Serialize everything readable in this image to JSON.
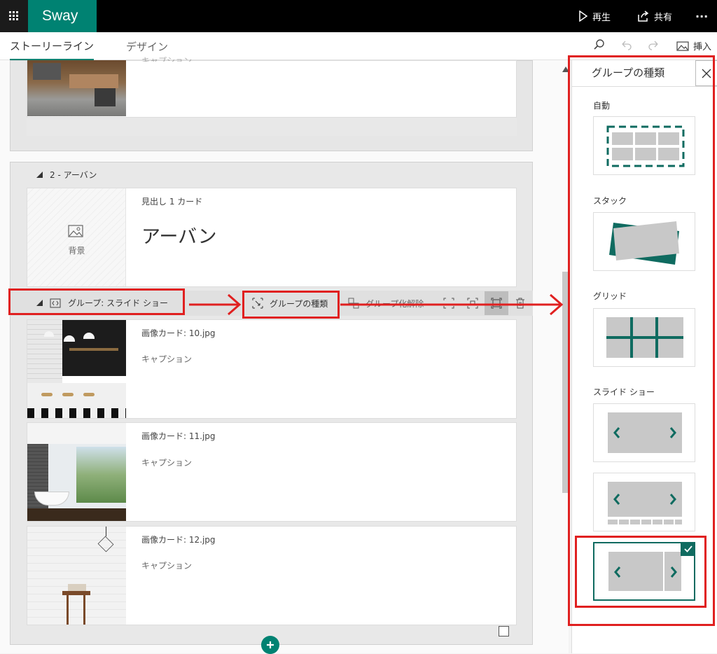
{
  "app": {
    "brand": "Sway",
    "play_label": "再生",
    "share_label": "共有",
    "more_label": "···"
  },
  "tabs": [
    {
      "label": "ストーリーライン"
    },
    {
      "label": "デザイン"
    }
  ],
  "toolbar_right": {
    "insert_label": "挿入"
  },
  "sections": {
    "section2_title": "2 - アーバン",
    "heading_card_label": "見出し 1 カード",
    "heading_text": "アーバン",
    "background_label": "背景",
    "top_caption_partial": "キャプション"
  },
  "group": {
    "label": "グループ: スライド ショー",
    "type_button": "グループの種類",
    "ungroup_button": "グループ化解除"
  },
  "image_cards": [
    {
      "label": "画像カード: ",
      "filename": "10.jpg",
      "caption": "キャプション"
    },
    {
      "label": "画像カード: ",
      "filename": "11.jpg",
      "caption": "キャプション"
    },
    {
      "label": "画像カード: ",
      "filename": "12.jpg",
      "caption": "キャプション"
    }
  ],
  "panel": {
    "title": "グループの種類",
    "options": [
      {
        "label": "自動"
      },
      {
        "label": "スタック"
      },
      {
        "label": "グリッド"
      },
      {
        "label": "スライド ショー"
      }
    ]
  },
  "colors": {
    "accent": "#008272",
    "annotation_red": "#e02020"
  }
}
